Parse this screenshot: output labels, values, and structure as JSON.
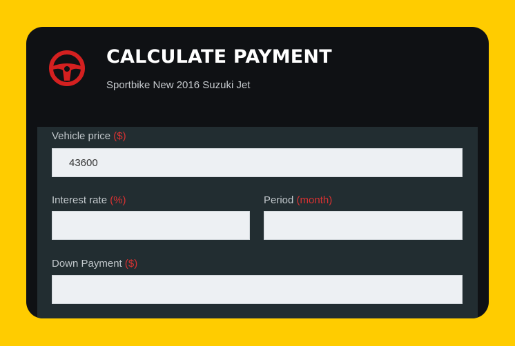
{
  "header": {
    "title": "CALCULATE PAYMENT",
    "subtitle": "Sportbike New 2016 Suzuki Jet",
    "icon": "steering-wheel-icon"
  },
  "form": {
    "vehicle_price": {
      "label": "Vehicle price",
      "unit": "($)",
      "value": "43600",
      "placeholder": ""
    },
    "interest_rate": {
      "label": "Interest rate",
      "unit": "(%)",
      "value": "",
      "placeholder": ""
    },
    "period": {
      "label": "Period",
      "unit": "(month)",
      "value": "",
      "placeholder": ""
    },
    "down_payment": {
      "label": "Down Payment",
      "unit": "($)",
      "value": "",
      "placeholder": ""
    }
  },
  "colors": {
    "background": "#ffcc00",
    "card": "#0f1114",
    "panel": "#222d31",
    "accent": "#d93232",
    "input": "#edf0f3"
  }
}
